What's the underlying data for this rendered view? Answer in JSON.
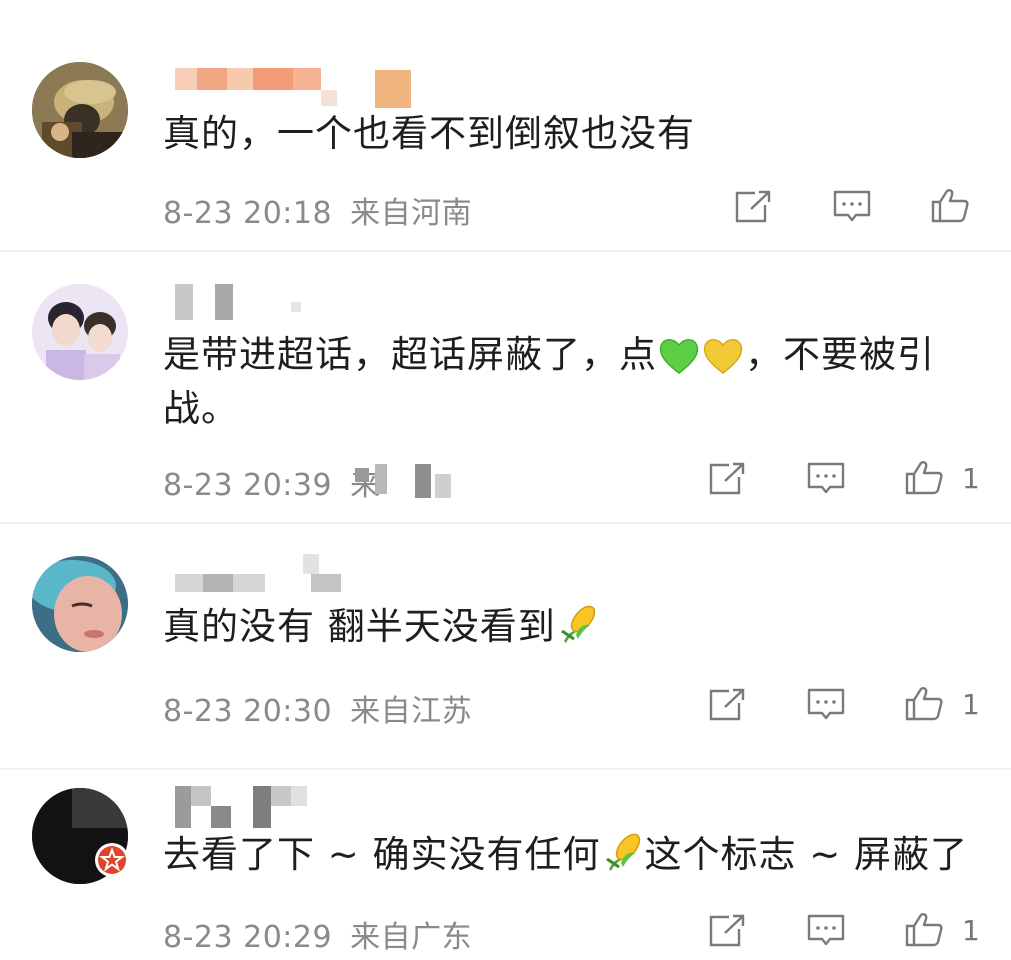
{
  "comments": [
    {
      "text": "真的，一个也看不到倒叙也没有",
      "time": "8-23 20:18",
      "location": "来自河南",
      "likes": ""
    },
    {
      "text_a": "是带进超话，超话屏蔽了，点",
      "text_b": "，不要被引",
      "text_c": "战。",
      "time": "8-23 20:39",
      "location": "来",
      "likes": "1"
    },
    {
      "text": "真的没有 翻半天没看到",
      "time": "8-23 20:30",
      "location": "来自江苏",
      "likes": "1"
    },
    {
      "text_a": "去看了下 ~ 确实没有任何",
      "text_b": "这个标志 ~ 屏蔽了",
      "time": "8-23 20:29",
      "location": "来自广东",
      "likes": "1"
    }
  ],
  "icons": {
    "share": "share-icon",
    "comment": "comment-icon",
    "like": "thumbs-up-icon",
    "corn": "corn-emoji-icon",
    "green_heart": "green-heart-emoji-icon",
    "yellow_heart": "yellow-heart-emoji-icon"
  },
  "colors": {
    "meta_text": "#8a8a8a",
    "body_text": "#1e1e1e",
    "icon_stroke": "#7a7a7a",
    "verified_badge": "#e0452b"
  }
}
